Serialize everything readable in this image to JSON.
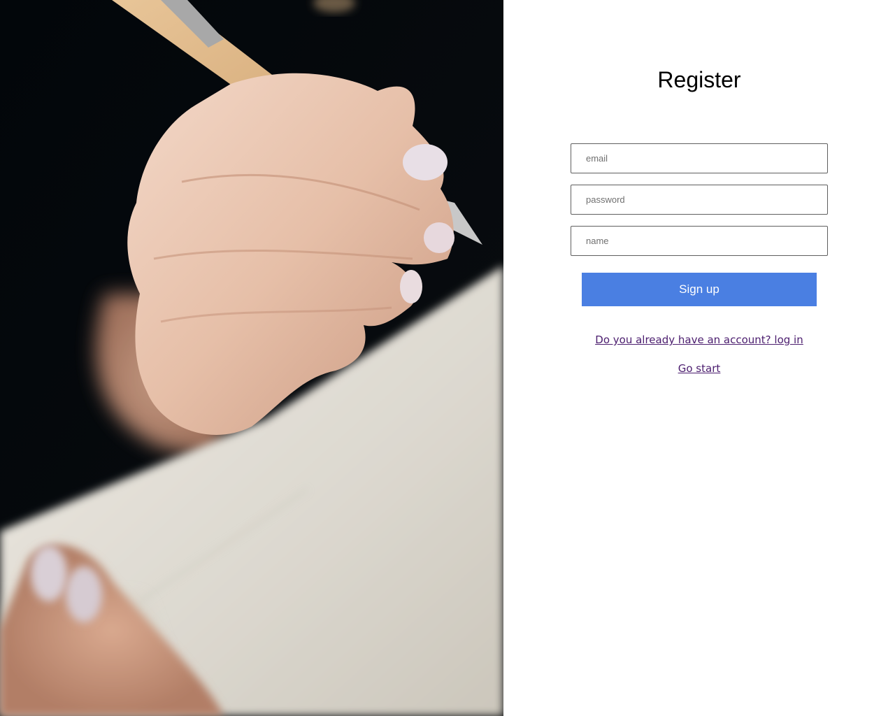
{
  "form": {
    "title": "Register",
    "email_placeholder": "email",
    "password_placeholder": "password",
    "name_placeholder": "name",
    "submit_label": "Sign up",
    "login_link": "Do you already have an account? log in",
    "start_link": "Go start"
  },
  "colors": {
    "button": "#4a7fe2",
    "link_visited": "#4b1d6e",
    "hero_background": "#04070b"
  },
  "hero": {
    "description_icon": "hand-writing-photo"
  }
}
